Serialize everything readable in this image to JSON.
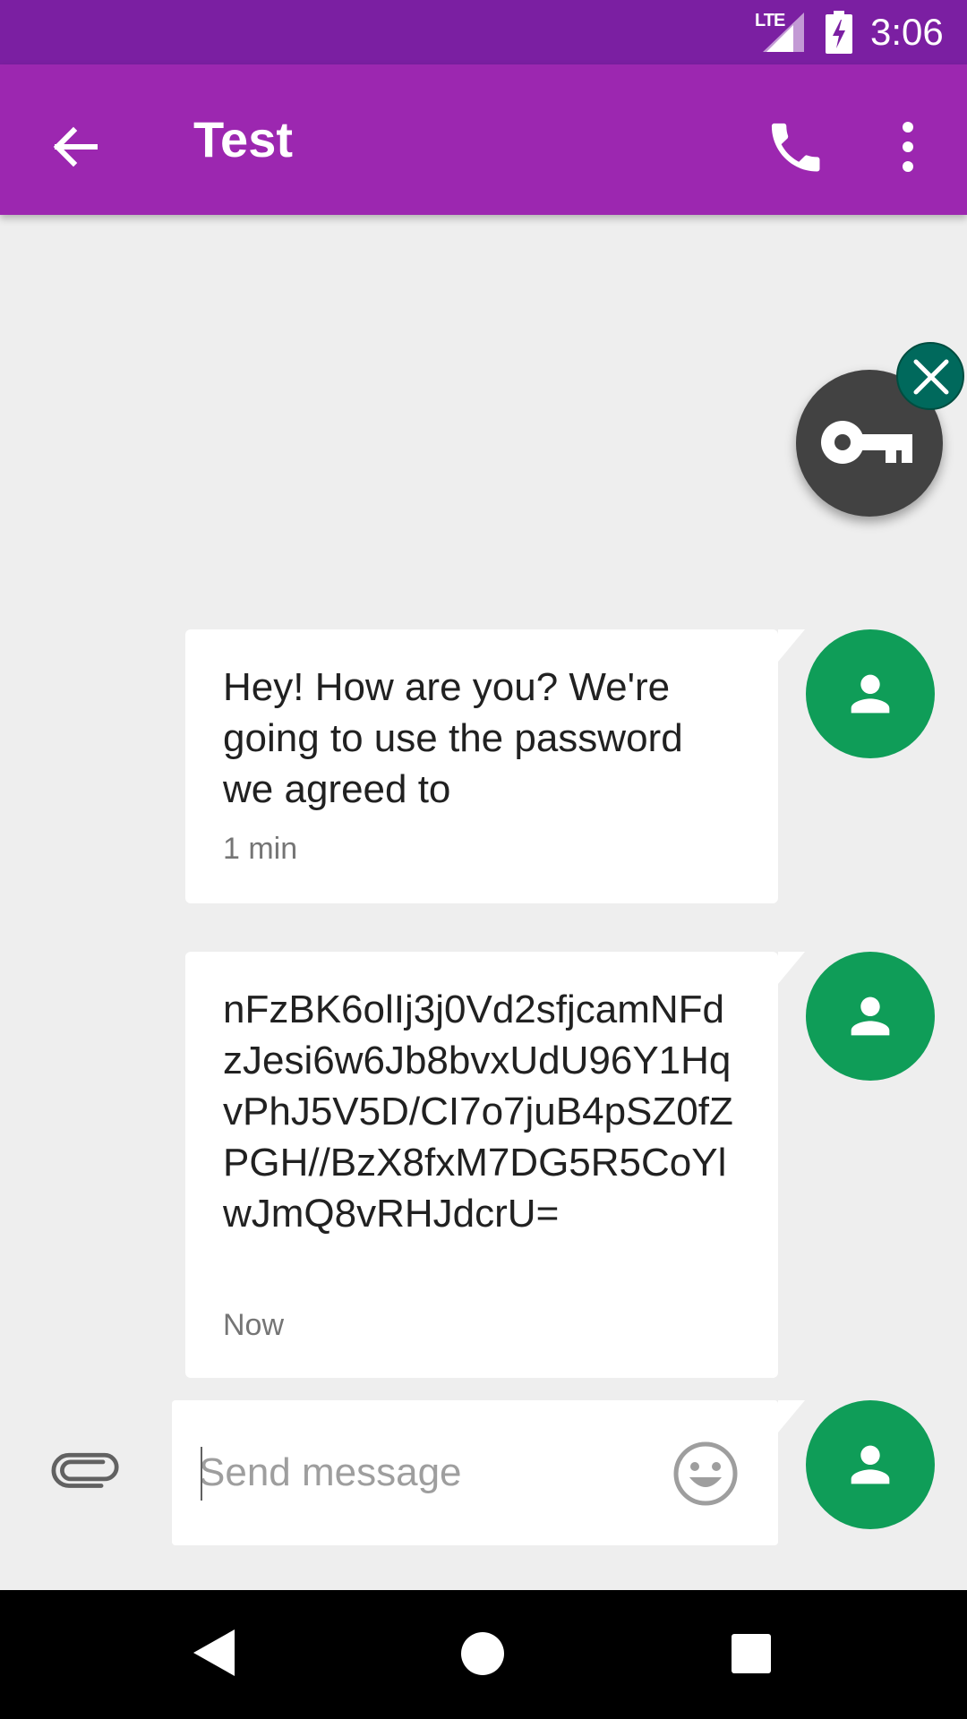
{
  "status_bar": {
    "network": "LTE",
    "time": "3:06",
    "icons": [
      "signal-icon",
      "battery-charging-icon"
    ]
  },
  "app_bar": {
    "title": "Test",
    "icons": [
      "back-arrow-icon",
      "phone-icon",
      "more-vert-icon"
    ]
  },
  "floating_bubble": {
    "icon": "key-icon",
    "close_icon": "close-icon",
    "colors": {
      "bubble": "#424242",
      "close": "#00695c"
    }
  },
  "messages": [
    {
      "text": "Hey! How are you? We're going to use the password we agreed to",
      "time": "1 min",
      "avatar_icon": "person-icon"
    },
    {
      "text": "nFzBK6olIj3j0Vd2sfjcamNFdzJesi6w6Jb8bvxUdU96Y1HqvPhJ5V5D/CI7o7juB4pSZ0fZPGH//BzX8fxM7DG5R5CoYlwJmQ8vRHJdcrU=",
      "time": "Now",
      "avatar_icon": "person-icon"
    }
  ],
  "compose": {
    "placeholder": "Send message",
    "value": "",
    "attach_icon": "attachment-icon",
    "emoji_icon": "emoji-icon"
  },
  "nav_bar": {
    "icons": [
      "nav-back-icon",
      "nav-home-icon",
      "nav-recents-icon"
    ]
  },
  "colors": {
    "status_bar": "#7b1fa2",
    "app_bar": "#9c27b0",
    "avatar": "#0f9d58",
    "background": "#eeeeee"
  }
}
